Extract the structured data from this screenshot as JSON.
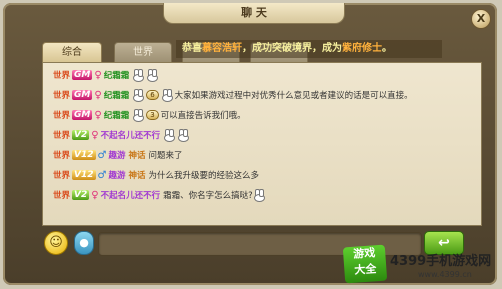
{
  "window": {
    "title": "聊 天",
    "close_label": "X"
  },
  "tabs": [
    {
      "label": "综合",
      "active": true
    },
    {
      "label": "世界",
      "active": false
    },
    {
      "label": "",
      "active": false
    },
    {
      "label": "",
      "active": false
    }
  ],
  "announcement": {
    "prefix": "恭喜",
    "player": "慕容浩轩",
    "middle": "，成功突破境界，成为",
    "rank": "紫府修士",
    "suffix": "。"
  },
  "messages": [
    {
      "channel": "世界",
      "badge": "GM",
      "badge_type": "gm",
      "gender": "♀",
      "name": "纪霜霜",
      "name_color": "green",
      "level": "",
      "text": "",
      "bunnies": 2
    },
    {
      "channel": "世界",
      "badge": "GM",
      "badge_type": "gm",
      "gender": "♀",
      "name": "纪霜霜",
      "name_color": "green",
      "level": "6",
      "text": "大家如果游戏过程中对优秀什么意见或者建议的话是可以直接。",
      "bunnies": 1
    },
    {
      "channel": "世界",
      "badge": "GM",
      "badge_type": "gm",
      "gender": "♀",
      "name": "纪霜霜",
      "name_color": "green",
      "level": "3",
      "text": "可以直接告诉我们哦。",
      "bunnies": 1
    },
    {
      "channel": "世界",
      "badge": "V2",
      "badge_type": "v",
      "gender": "♀",
      "name": "不起名儿还不行",
      "name_color": "purple",
      "level": "",
      "text": "",
      "bunnies": 2
    },
    {
      "channel": "世界",
      "badge": "V12",
      "badge_type": "vgold",
      "gender": "♂",
      "name": "趣游",
      "name2": "神话",
      "name_color": "purple",
      "level": "",
      "text": "问题来了",
      "bunnies": 0
    },
    {
      "channel": "世界",
      "badge": "V12",
      "badge_type": "vgold",
      "gender": "♂",
      "name": "趣游",
      "name2": "神话",
      "name_color": "purple",
      "level": "",
      "text": "为什么我升级要的经验这么多",
      "bunnies": 0
    },
    {
      "channel": "世界",
      "badge": "V2",
      "badge_type": "v",
      "gender": "♀",
      "name": "不起名儿还不行",
      "name_color": "purple",
      "level": "",
      "text": "霜霜、你名字怎么搞哒?",
      "bunnies": 1
    }
  ],
  "input": {
    "placeholder": ""
  },
  "send_label": "↩",
  "emoji_icon": "smiley-icon",
  "mic_icon": "microphone-icon",
  "watermark": {
    "logo_line1": "游戏",
    "logo_line2": "大全",
    "text": "4399手机游戏网",
    "url": "www.4399.cn"
  }
}
